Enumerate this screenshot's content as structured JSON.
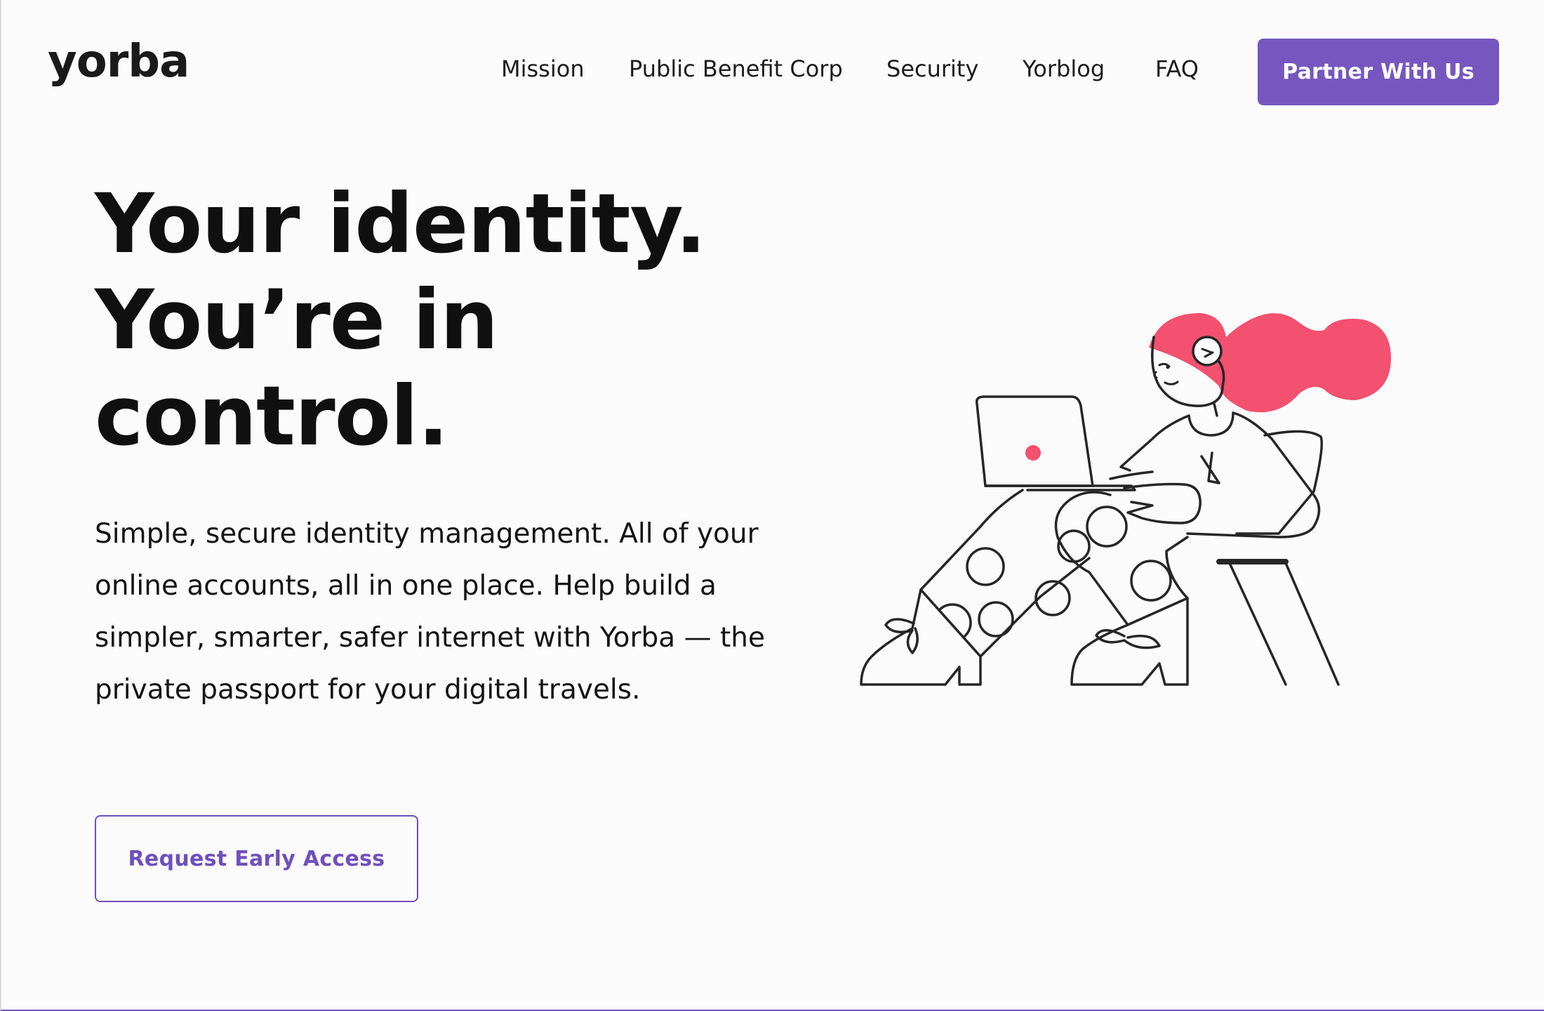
{
  "header": {
    "logo_text": "yorba",
    "nav": [
      {
        "label": "Mission"
      },
      {
        "label": "Public Benefit Corp"
      },
      {
        "label": "Security"
      },
      {
        "label": "Yorblog"
      },
      {
        "label": "FAQ"
      }
    ],
    "partner_button_label": "Partner With Us"
  },
  "hero": {
    "headline_lines": [
      "Your identity.",
      "You’re in",
      "control."
    ],
    "subcopy": "Simple, secure identity management. All of your online accounts, all in one place. Help build a simpler, smarter, safer internet with Yorba — the private passport for your digital travels.",
    "cta_label": "Request Early Access"
  },
  "colors": {
    "accent": "#7657bf",
    "illustration_accent": "#f4506f",
    "background": "#fbfbfb",
    "text": "#111111"
  },
  "icons": {
    "hero_illustration": "woman-with-laptop-illustration"
  }
}
